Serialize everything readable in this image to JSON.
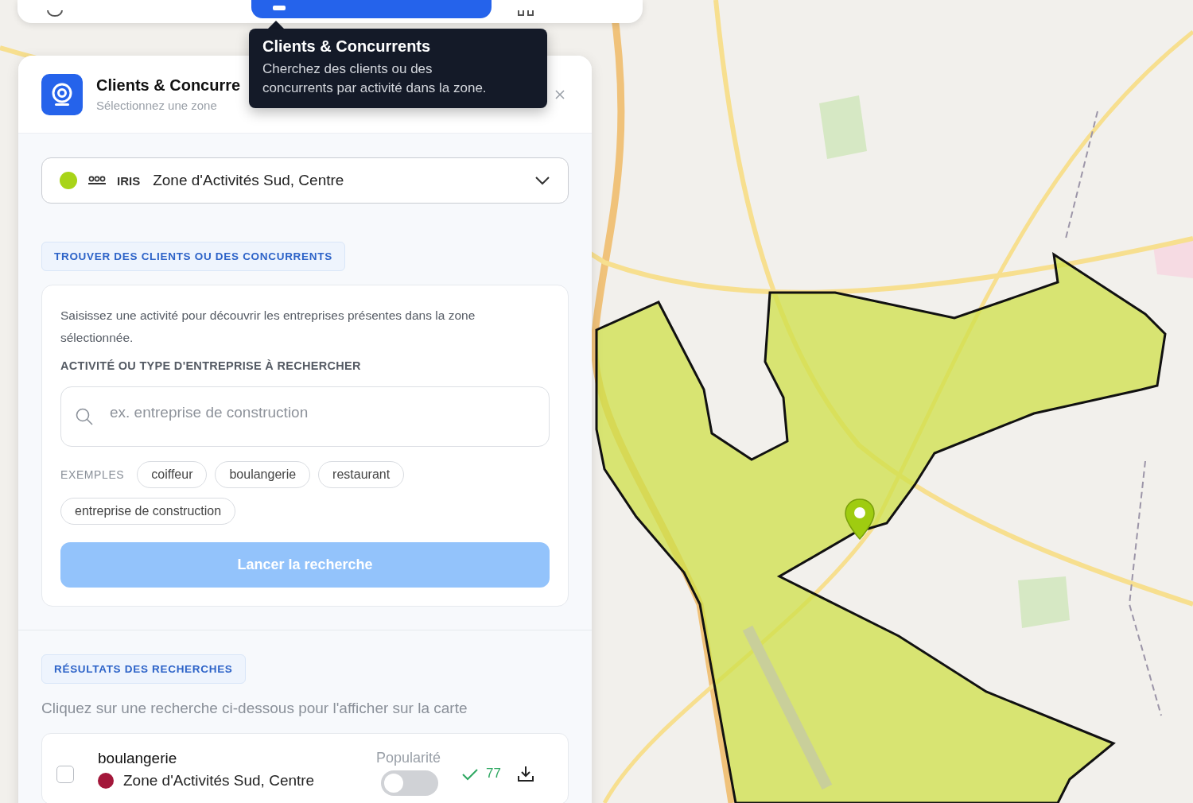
{
  "toolbar": {
    "tabs": [
      {
        "selected": false
      },
      {
        "selected": true
      },
      {
        "selected": false
      }
    ]
  },
  "tooltip": {
    "title": "Clients & Concurrents",
    "text": "Cherchez des clients ou des concurrents par activité dans la zone."
  },
  "panel": {
    "title": "Clients & Concurre",
    "subtitle": "Sélectionnez une zone"
  },
  "zone": {
    "color": "#a8d418",
    "type": "IRIS",
    "name": "Zone d'Activités Sud, Centre"
  },
  "search_section": {
    "heading": "TROUVER DES CLIENTS OU DES CONCURRENTS",
    "description": "Saisissez une activité pour découvrir les entreprises présentes dans la zone sélectionnée.",
    "field_label": "ACTIVITÉ OU TYPE D'ENTREPRISE À RECHERCHER",
    "placeholder": "ex. entreprise de construction",
    "examples_label": "EXEMPLES",
    "examples": [
      "coiffeur",
      "boulangerie",
      "restaurant",
      "entreprise de construction"
    ],
    "button": {
      "label": "Lancer la recherche",
      "disabled": true
    }
  },
  "results_section": {
    "heading": "RÉSULTATS DES RECHERCHES",
    "hint": "Cliquez sur une recherche ci-dessous pour l'afficher sur la carte",
    "results": [
      {
        "checked": false,
        "query": "boulangerie",
        "zone": "Zone d'Activités Sud, Centre",
        "color": "#a3173a",
        "popularity_label": "Popularité",
        "popularity_on": false,
        "count": "77"
      }
    ]
  }
}
